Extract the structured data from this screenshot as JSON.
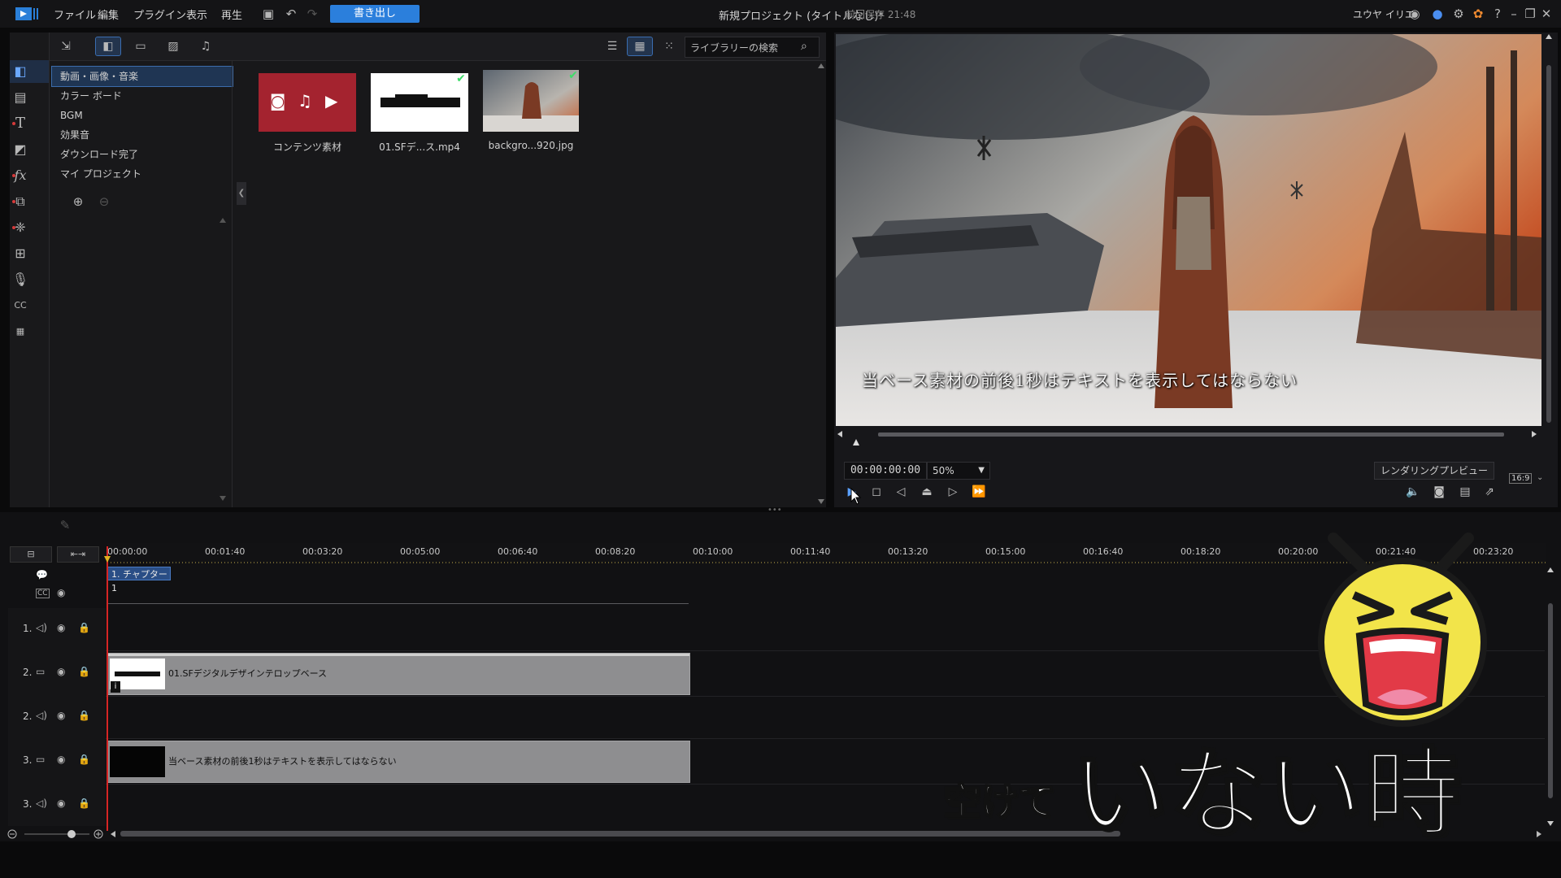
{
  "menubar": {
    "items": [
      "ファイル",
      "編集",
      "プラグイン",
      "表示",
      "再生"
    ],
    "export_label": "書き出し",
    "title": "新規プロジェクト (タイトルなし)*",
    "saved": "前回保存 21:48",
    "user": "ユウヤ イリエ"
  },
  "library": {
    "search_placeholder": "ライブラリーの検索",
    "categories": [
      "動画・画像・音楽",
      "カラー ボード",
      "BGM",
      "効果音",
      "ダウンロード完了",
      "マイ プロジェクト"
    ],
    "media": [
      {
        "label": "コンテンツ素材"
      },
      {
        "label": "01.SFデ...ス.mp4"
      },
      {
        "label": "backgro...920.jpg"
      }
    ]
  },
  "preview": {
    "caption": "当ベース素材の前後1秒はテキストを表示してはならない",
    "timecode": "00:00:00:00",
    "zoom": "50%",
    "render_label": "レンダリングプレビュー",
    "aspect": "16:9"
  },
  "timeline": {
    "ticks": [
      "00:00:00",
      "00:01:40",
      "00:03:20",
      "00:05:00",
      "00:06:40",
      "00:08:20",
      "00:10:00",
      "00:11:40",
      "00:13:20",
      "00:15:00",
      "00:16:40",
      "00:18:20",
      "00:20:00",
      "00:21:40",
      "00:23:20"
    ],
    "chapter": "1. チャプター 1",
    "tracks": [
      {
        "label": "1."
      },
      {
        "label": "2."
      },
      {
        "label": "2."
      },
      {
        "label": "3."
      },
      {
        "label": "3."
      }
    ],
    "clips": [
      {
        "label": "01.SFデジタルデザインテロップベース"
      },
      {
        "label": "当ベース素材の前後1秒はテキストを表示してはならない"
      }
    ]
  },
  "overlay": {
    "small": "空けて",
    "big": "いない時"
  },
  "colors": {
    "accent": "#2b7fdc",
    "playhead": "#d62525",
    "clip": "#8e8e90",
    "media_tile": "#a4232f"
  }
}
